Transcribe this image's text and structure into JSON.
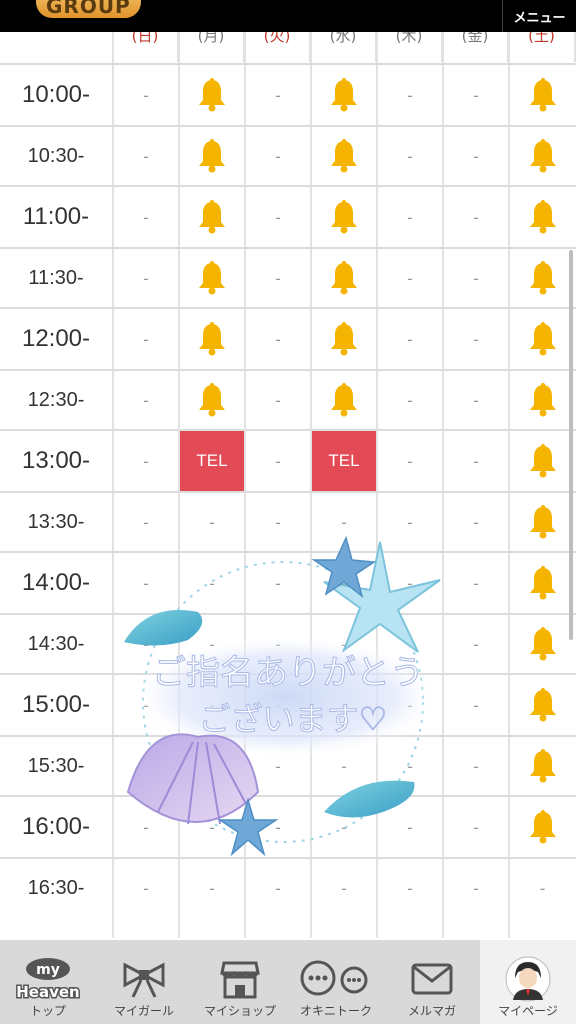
{
  "header": {
    "logo_text": "GROUP",
    "menu_label": "メニュー"
  },
  "schedule": {
    "days": [
      {
        "label": "(日)",
        "holiday": true
      },
      {
        "label": "(月)",
        "holiday": false
      },
      {
        "label": "(火)",
        "holiday": true
      },
      {
        "label": "(水)",
        "holiday": false
      },
      {
        "label": "(木)",
        "holiday": false
      },
      {
        "label": "(金)",
        "holiday": false
      },
      {
        "label": "(土)",
        "holiday": true
      }
    ],
    "rows": [
      {
        "time": "10:00-",
        "cells": [
          "-",
          "bell",
          "-",
          "bell",
          "-",
          "-",
          "bell"
        ]
      },
      {
        "time": "10:30-",
        "cells": [
          "-",
          "bell",
          "-",
          "bell",
          "-",
          "-",
          "bell"
        ]
      },
      {
        "time": "11:00-",
        "cells": [
          "-",
          "bell",
          "-",
          "bell",
          "-",
          "-",
          "bell"
        ]
      },
      {
        "time": "11:30-",
        "cells": [
          "-",
          "bell",
          "-",
          "bell",
          "-",
          "-",
          "bell"
        ]
      },
      {
        "time": "12:00-",
        "cells": [
          "-",
          "bell",
          "-",
          "bell",
          "-",
          "-",
          "bell"
        ]
      },
      {
        "time": "12:30-",
        "cells": [
          "-",
          "bell",
          "-",
          "bell",
          "-",
          "-",
          "bell"
        ]
      },
      {
        "time": "13:00-",
        "cells": [
          "-",
          "TEL",
          "-",
          "TEL",
          "-",
          "-",
          "bell"
        ]
      },
      {
        "time": "13:30-",
        "cells": [
          "-",
          "-",
          "-",
          "-",
          "-",
          "-",
          "bell"
        ]
      },
      {
        "time": "14:00-",
        "cells": [
          "-",
          "-",
          "-",
          "-",
          "-",
          "-",
          "bell"
        ]
      },
      {
        "time": "14:30-",
        "cells": [
          "-",
          "-",
          "-",
          "-",
          "-",
          "-",
          "bell"
        ]
      },
      {
        "time": "15:00-",
        "cells": [
          "-",
          "-",
          "-",
          "-",
          "-",
          "-",
          "bell"
        ]
      },
      {
        "time": "15:30-",
        "cells": [
          "-",
          "-",
          "-",
          "-",
          "-",
          "-",
          "bell"
        ]
      },
      {
        "time": "16:00-",
        "cells": [
          "-",
          "-",
          "-",
          "-",
          "-",
          "-",
          "bell"
        ]
      },
      {
        "time": "16:30-",
        "cells": [
          "-",
          "-",
          "-",
          "-",
          "-",
          "-",
          "-"
        ]
      }
    ]
  },
  "overlay": {
    "line1": "ご指名ありがとう",
    "line2": "ございます♡"
  },
  "bottom_nav": [
    {
      "label": "トップ",
      "icon": "my-heaven-logo-icon",
      "logo_top": "my",
      "logo_bottom": "Heaven"
    },
    {
      "label": "マイガール",
      "icon": "ribbon-icon"
    },
    {
      "label": "マイショップ",
      "icon": "shop-icon"
    },
    {
      "label": "オキニトーク",
      "icon": "chat-bubbles-icon"
    },
    {
      "label": "メルマガ",
      "icon": "mail-icon"
    },
    {
      "label": "マイページ",
      "icon": "avatar-icon"
    }
  ],
  "colors": {
    "bell": "#f5b400",
    "tel": "#e24a55",
    "holiday": "#c0392b",
    "nav_bg": "#d9d9d9"
  }
}
